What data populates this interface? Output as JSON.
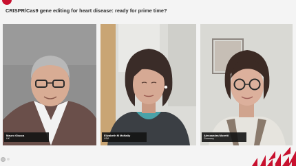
{
  "header": {
    "title": "CRISPR/Cas9 gene editing for heart disease: ready for prime time?"
  },
  "participants": [
    {
      "name": "Mauro Giacca",
      "country": "UK"
    },
    {
      "name": "Elizabeth M McNally",
      "country": "USA"
    },
    {
      "name": "Alessandra Moretti",
      "country": "Germany"
    }
  ],
  "brand": {
    "accent_color": "#c8102e"
  }
}
